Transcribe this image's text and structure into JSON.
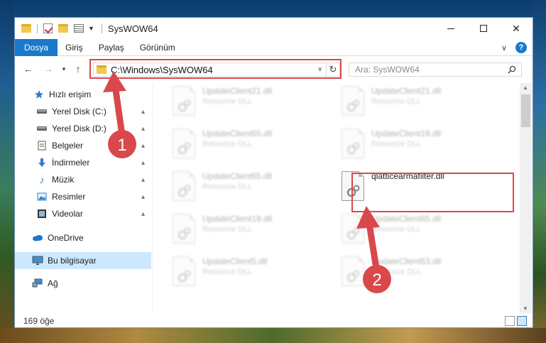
{
  "titlebar": {
    "title": "SysWOW64"
  },
  "ribbon": {
    "tabs": [
      "Dosya",
      "Giriş",
      "Paylaş",
      "Görünüm"
    ],
    "help_label": "?"
  },
  "navigation": {
    "address": "C:\\Windows\\SysWOW64",
    "search_placeholder": "Ara: SysWOW64"
  },
  "sidebar": {
    "items": [
      {
        "label": "Hızlı erişim",
        "icon": "star-icon"
      },
      {
        "label": "Yerel Disk (C:)",
        "icon": "drive-icon",
        "pinned": true
      },
      {
        "label": "Yerel Disk (D:)",
        "icon": "drive-icon",
        "pinned": true
      },
      {
        "label": "Belgeler",
        "icon": "documents-icon",
        "pinned": true
      },
      {
        "label": "İndirmeler",
        "icon": "download-icon",
        "pinned": true
      },
      {
        "label": "Müzik",
        "icon": "music-icon",
        "pinned": true
      },
      {
        "label": "Resimler",
        "icon": "pictures-icon",
        "pinned": true
      },
      {
        "label": "Videolar",
        "icon": "videos-icon",
        "pinned": true
      },
      {
        "label": "OneDrive",
        "icon": "cloud-icon"
      },
      {
        "label": "Bu bilgisayar",
        "icon": "computer-icon",
        "selected": true
      },
      {
        "label": "Ağ",
        "icon": "network-icon"
      }
    ]
  },
  "files": [
    {
      "name": "UpdateClient21.dll",
      "type": "Resource DLL"
    },
    {
      "name": "UpdateClient21.dll",
      "type": "Resource DLL"
    },
    {
      "name": "UpdateClient65.dll",
      "type": "Resource DLL"
    },
    {
      "name": "UpdateClient19.dll",
      "type": "Resource DLL"
    },
    {
      "name": "UpdateClient65.dll",
      "type": "Resource DLL"
    },
    {
      "name": "qlatticearmafilter.dll",
      "type": ""
    },
    {
      "name": "UpdateClient19.dll",
      "type": "Resource DLL"
    },
    {
      "name": "UpdateClient65.dll",
      "type": "Resource DLL"
    },
    {
      "name": "UpdateClient5.dll",
      "type": "Resource DLL"
    },
    {
      "name": "UpdateClient63.dll",
      "type": "Resource DLL"
    }
  ],
  "annotations": {
    "step1": "1",
    "step2": "2",
    "color": "#d9484b"
  },
  "status": {
    "item_count": "169 öğe"
  },
  "colors": {
    "accent": "#1979ca",
    "selection": "#cce8ff",
    "highlight": "#d9484b"
  }
}
